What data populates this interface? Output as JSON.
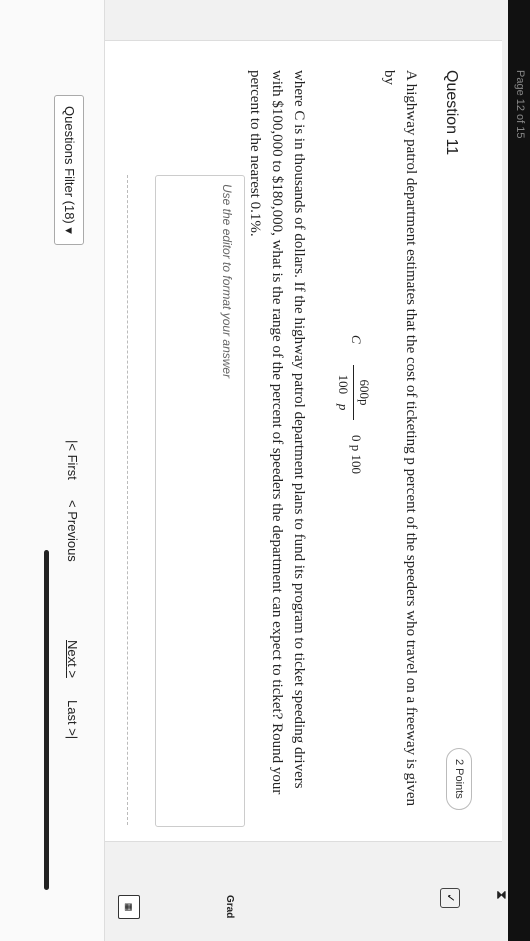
{
  "header": {
    "page_label": "Page 12 of 15"
  },
  "question": {
    "title": "Question 11",
    "points": "2 Points",
    "text_intro": "A highway patrol department estimates that the cost of ticketing p percent of the speeders who travel on a freeway is given by",
    "formula": {
      "lhs": "C",
      "numerator": "600p",
      "denominator": "100",
      "denominator_var": "p",
      "condition": "0    p    100"
    },
    "text_body": "where C is in thousands of dollars. If the highway patrol department plans to fund its program to ticket speeding drivers with $100,000 to $180,000, what is the range of the percent of speeders the department can expect to ticket? Round your percent to the nearest 0.1%.",
    "editor_placeholder": "Use the editor to format your answer"
  },
  "footer": {
    "filter_label": "Questions Filter (18)",
    "first_label": "First",
    "previous_label": "Previous",
    "next_label": "Next",
    "last_label": "Last"
  },
  "side": {
    "grade_label": "Grad",
    "top_right_label": "T"
  }
}
